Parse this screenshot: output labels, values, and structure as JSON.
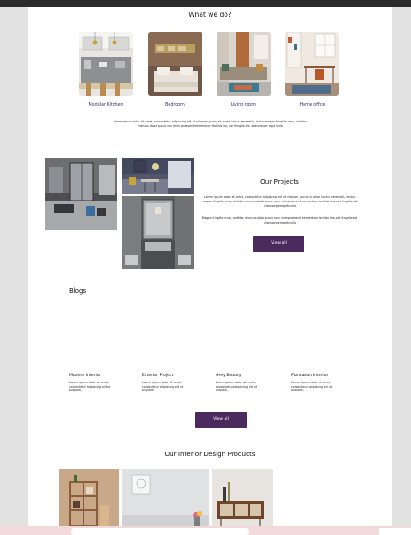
{
  "services": {
    "heading": "What we do?",
    "items": [
      {
        "label": "Modular Kitchen"
      },
      {
        "label": "Bedroom"
      },
      {
        "label": "Living room"
      },
      {
        "label": "Home office"
      }
    ],
    "description": "Lorem ipsum dolor sit amet, consectetur adipiscing elit ut aliquam, purus sit amet luctus venenatis, lectus magna fringilla urna, porttitor rhoncus dolor purus non enim praesent elementum facilisis leo, vel fringilla est ullamcorper eget nulla"
  },
  "projects": {
    "heading": "Our Projects",
    "paragraph1": "Lorem ipsum dolor sit amet, consectetur adipiscing elit ut aliquam, purus sit amet luctus venenatis, lectus magna fringilla urna, porttitor rhoncus dolor purus non enim praesent elementum facilisis leo, vel fringilla est ullamcorper eget nulla",
    "paragraph2": "Magna fringilla urna, porttitor rhoncus dolor purus non enim praesent elementum facilisis leo, vel fringilla est ullamcorper eget nulla",
    "button": "View all"
  },
  "blogs": {
    "heading": "Blogs",
    "items": [
      {
        "title": "Modern Interior",
        "text": "Lorem ipsum dolor sit amet, consectetur adipiscing elit ut aliquam,"
      },
      {
        "title": "Exterior Project",
        "text": "Lorem ipsum dolor sit amet, consectetur adipiscing elit ut aliquam,"
      },
      {
        "title": "Grey Beauty",
        "text": "Lorem ipsum dolor sit amet, consectetur adipiscing elit ut aliquam,"
      },
      {
        "title": "Plantation Interior",
        "text": "Lorem ipsum dolor sit amet, consectetur adipiscing elit ut aliquam,"
      }
    ],
    "button": "View all"
  },
  "products": {
    "heading": "Our Interior Design Products"
  },
  "colors": {
    "accent": "#4b2a5e",
    "label": "#4a2a66"
  }
}
